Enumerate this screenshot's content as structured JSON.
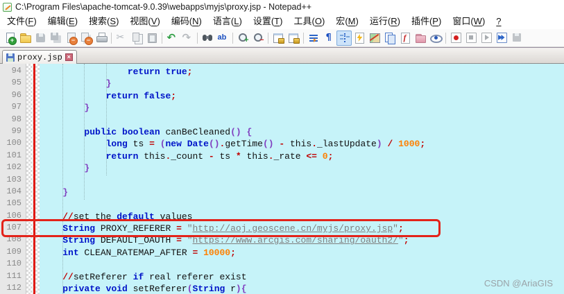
{
  "window": {
    "title": "C:\\Program Files\\apache-tomcat-9.0.39\\webapps\\myjs\\proxy.jsp - Notepad++"
  },
  "menu": {
    "items": [
      {
        "id": "file",
        "text": "文件",
        "key": "F"
      },
      {
        "id": "edit",
        "text": "编辑",
        "key": "E"
      },
      {
        "id": "search",
        "text": "搜索",
        "key": "S"
      },
      {
        "id": "view",
        "text": "视图",
        "key": "V"
      },
      {
        "id": "encoding",
        "text": "编码",
        "key": "N"
      },
      {
        "id": "language",
        "text": "语言",
        "key": "L"
      },
      {
        "id": "settings",
        "text": "设置",
        "key": "T"
      },
      {
        "id": "tools",
        "text": "工具",
        "key": "O"
      },
      {
        "id": "macro",
        "text": "宏",
        "key": "M"
      },
      {
        "id": "run",
        "text": "运行",
        "key": "R"
      },
      {
        "id": "plugins",
        "text": "插件",
        "key": "P"
      },
      {
        "id": "window",
        "text": "窗口",
        "key": "W"
      },
      {
        "id": "help",
        "text": "",
        "key": "?"
      }
    ]
  },
  "toolbar": {
    "buttons": [
      {
        "name": "new-file"
      },
      {
        "name": "open-file"
      },
      {
        "name": "save",
        "disabled": true
      },
      {
        "name": "save-all",
        "disabled": true
      },
      {
        "name": "close",
        "disabled": true
      },
      {
        "name": "close-all",
        "disabled": true
      },
      {
        "name": "print"
      },
      {
        "sep": true
      },
      {
        "name": "cut",
        "disabled": true
      },
      {
        "name": "copy",
        "disabled": true
      },
      {
        "name": "paste",
        "disabled": true
      },
      {
        "sep": true
      },
      {
        "name": "undo"
      },
      {
        "name": "redo",
        "disabled": true
      },
      {
        "sep": true
      },
      {
        "name": "find"
      },
      {
        "name": "replace"
      },
      {
        "sep": true
      },
      {
        "name": "zoom-in"
      },
      {
        "name": "zoom-out"
      },
      {
        "sep": true
      },
      {
        "name": "sync-vertical"
      },
      {
        "name": "sync-horizontal"
      },
      {
        "sep": true
      },
      {
        "name": "word-wrap"
      },
      {
        "name": "show-all-characters"
      },
      {
        "name": "indent-guide",
        "pressed": true
      },
      {
        "name": "user-defined-language"
      },
      {
        "name": "document-map"
      },
      {
        "name": "document-list"
      },
      {
        "name": "function-list"
      },
      {
        "name": "folder-as-workspace"
      },
      {
        "name": "monitoring"
      },
      {
        "sep": true
      },
      {
        "name": "macro-record"
      },
      {
        "name": "macro-stop",
        "disabled": true
      },
      {
        "name": "macro-play",
        "disabled": true
      },
      {
        "name": "macro-run"
      },
      {
        "name": "macro-save",
        "disabled": true
      }
    ]
  },
  "tabs": {
    "active": {
      "label": "proxy.jsp"
    }
  },
  "editor": {
    "watermark": "CSDN @AriaGIS",
    "palette": {
      "editor_bg": "#c6f3f9",
      "keyword": "#0014c8",
      "operator": "#c00000",
      "bracket": "#8040c0",
      "number": "#ff8000",
      "string": "#808080",
      "annotation_box": "#e3231a",
      "change_marker": "#e01810"
    },
    "lines": [
      {
        "num": 94,
        "tokens": [
          {
            "t": "                ",
            "c": "pl"
          },
          {
            "t": "return",
            "c": "kw"
          },
          {
            "t": " ",
            "c": "pl"
          },
          {
            "t": "true",
            "c": "kw"
          },
          {
            "t": ";",
            "c": "op"
          }
        ]
      },
      {
        "num": 95,
        "tokens": [
          {
            "t": "            ",
            "c": "pl"
          },
          {
            "t": "}",
            "c": "br"
          }
        ]
      },
      {
        "num": 96,
        "tokens": [
          {
            "t": "            ",
            "c": "pl"
          },
          {
            "t": "return",
            "c": "kw"
          },
          {
            "t": " ",
            "c": "pl"
          },
          {
            "t": "false",
            "c": "kw"
          },
          {
            "t": ";",
            "c": "op"
          }
        ]
      },
      {
        "num": 97,
        "tokens": [
          {
            "t": "        ",
            "c": "pl"
          },
          {
            "t": "}",
            "c": "br"
          }
        ]
      },
      {
        "num": 98,
        "tokens": []
      },
      {
        "num": 99,
        "tokens": [
          {
            "t": "        ",
            "c": "pl"
          },
          {
            "t": "public",
            "c": "kw"
          },
          {
            "t": " ",
            "c": "pl"
          },
          {
            "t": "boolean",
            "c": "kw"
          },
          {
            "t": " canBeCleaned",
            "c": "pl"
          },
          {
            "t": "()",
            "c": "br"
          },
          {
            "t": " ",
            "c": "pl"
          },
          {
            "t": "{",
            "c": "br"
          }
        ]
      },
      {
        "num": 100,
        "tokens": [
          {
            "t": "            ",
            "c": "pl"
          },
          {
            "t": "long",
            "c": "kw"
          },
          {
            "t": " ts ",
            "c": "pl"
          },
          {
            "t": "=",
            "c": "op"
          },
          {
            "t": " ",
            "c": "pl"
          },
          {
            "t": "(",
            "c": "br"
          },
          {
            "t": "new",
            "c": "kw"
          },
          {
            "t": " ",
            "c": "pl"
          },
          {
            "t": "Date",
            "c": "kw"
          },
          {
            "t": "()",
            "c": "br"
          },
          {
            "t": ".",
            "c": "op"
          },
          {
            "t": "getTime",
            "c": "pl"
          },
          {
            "t": "()",
            "c": "br"
          },
          {
            "t": " ",
            "c": "pl"
          },
          {
            "t": "-",
            "c": "op"
          },
          {
            "t": " this",
            "c": "pl"
          },
          {
            "t": ".",
            "c": "op"
          },
          {
            "t": "_lastUpdate",
            "c": "pl"
          },
          {
            "t": ")",
            "c": "br"
          },
          {
            "t": " ",
            "c": "pl"
          },
          {
            "t": "/",
            "c": "op"
          },
          {
            "t": " ",
            "c": "pl"
          },
          {
            "t": "1000",
            "c": "num"
          },
          {
            "t": ";",
            "c": "op"
          }
        ]
      },
      {
        "num": 101,
        "tokens": [
          {
            "t": "            ",
            "c": "pl"
          },
          {
            "t": "return",
            "c": "kw"
          },
          {
            "t": " this",
            "c": "pl"
          },
          {
            "t": ".",
            "c": "op"
          },
          {
            "t": "_count ",
            "c": "pl"
          },
          {
            "t": "-",
            "c": "op"
          },
          {
            "t": " ts ",
            "c": "pl"
          },
          {
            "t": "*",
            "c": "op"
          },
          {
            "t": " this",
            "c": "pl"
          },
          {
            "t": ".",
            "c": "op"
          },
          {
            "t": "_rate ",
            "c": "pl"
          },
          {
            "t": "<=",
            "c": "op"
          },
          {
            "t": " ",
            "c": "pl"
          },
          {
            "t": "0",
            "c": "num"
          },
          {
            "t": ";",
            "c": "op"
          }
        ]
      },
      {
        "num": 102,
        "tokens": [
          {
            "t": "        ",
            "c": "pl"
          },
          {
            "t": "}",
            "c": "br"
          }
        ]
      },
      {
        "num": 103,
        "tokens": []
      },
      {
        "num": 104,
        "tokens": [
          {
            "t": "    ",
            "c": "pl"
          },
          {
            "t": "}",
            "c": "br"
          }
        ]
      },
      {
        "num": 105,
        "tokens": []
      },
      {
        "num": 106,
        "tokens": [
          {
            "t": "    ",
            "c": "pl"
          },
          {
            "t": "//",
            "c": "op"
          },
          {
            "t": "set the ",
            "c": "pl"
          },
          {
            "t": "default",
            "c": "kw"
          },
          {
            "t": " values",
            "c": "pl"
          }
        ]
      },
      {
        "num": 107,
        "tokens": [
          {
            "t": "    ",
            "c": "pl"
          },
          {
            "t": "String",
            "c": "kw"
          },
          {
            "t": " PROXY_REFERER ",
            "c": "pl"
          },
          {
            "t": "=",
            "c": "op"
          },
          {
            "t": " ",
            "c": "pl"
          },
          {
            "t": "\"",
            "c": "str"
          },
          {
            "t": "http://aoj.geoscene.cn/myjs/proxy.jsp",
            "c": "url"
          },
          {
            "t": "\"",
            "c": "str"
          },
          {
            "t": ";",
            "c": "op"
          }
        ]
      },
      {
        "num": 108,
        "tokens": [
          {
            "t": "    ",
            "c": "pl"
          },
          {
            "t": "String",
            "c": "kw"
          },
          {
            "t": " DEFAULT_OAUTH ",
            "c": "pl"
          },
          {
            "t": "=",
            "c": "op"
          },
          {
            "t": " ",
            "c": "pl"
          },
          {
            "t": "\"",
            "c": "str"
          },
          {
            "t": "https://www.arcgis.com/sharing/oauth2/",
            "c": "url"
          },
          {
            "t": "\"",
            "c": "str"
          },
          {
            "t": ";",
            "c": "op"
          }
        ]
      },
      {
        "num": 109,
        "tokens": [
          {
            "t": "    ",
            "c": "pl"
          },
          {
            "t": "int",
            "c": "kw"
          },
          {
            "t": " CLEAN_RATEMAP_AFTER ",
            "c": "pl"
          },
          {
            "t": "=",
            "c": "op"
          },
          {
            "t": " ",
            "c": "pl"
          },
          {
            "t": "10000",
            "c": "num"
          },
          {
            "t": ";",
            "c": "op"
          }
        ]
      },
      {
        "num": 110,
        "tokens": []
      },
      {
        "num": 111,
        "tokens": [
          {
            "t": "    ",
            "c": "pl"
          },
          {
            "t": "//",
            "c": "op"
          },
          {
            "t": "setReferer ",
            "c": "pl"
          },
          {
            "t": "if",
            "c": "kw"
          },
          {
            "t": " real referer exist",
            "c": "pl"
          }
        ]
      },
      {
        "num": 112,
        "tokens": [
          {
            "t": "    ",
            "c": "pl"
          },
          {
            "t": "private",
            "c": "kw"
          },
          {
            "t": " ",
            "c": "pl"
          },
          {
            "t": "void",
            "c": "kw"
          },
          {
            "t": " setReferer",
            "c": "pl"
          },
          {
            "t": "(",
            "c": "br"
          },
          {
            "t": "String",
            "c": "kw"
          },
          {
            "t": " r",
            "c": "pl"
          },
          {
            "t": ")",
            "c": "br"
          },
          {
            "t": "{",
            "c": "br"
          }
        ]
      }
    ]
  }
}
